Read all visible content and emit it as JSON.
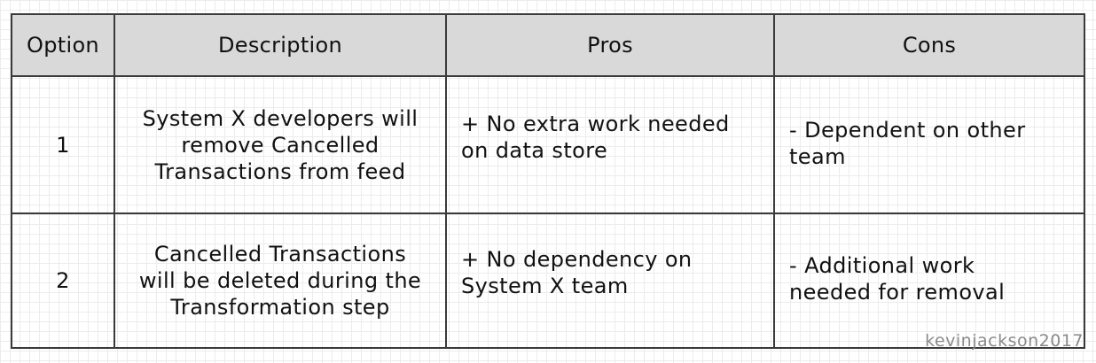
{
  "table": {
    "headers": {
      "option": "Option",
      "description": "Description",
      "pros": "Pros",
      "cons": "Cons"
    },
    "rows": [
      {
        "option": "1",
        "description": "System X developers will\nremove Cancelled\nTransactions from feed",
        "pros": "+ No extra work needed\non data store",
        "cons": "- Dependent on other\nteam"
      },
      {
        "option": "2",
        "description": "Cancelled Transactions\nwill be deleted during the\nTransformation step",
        "pros": "+ No dependency on\nSystem X team",
        "cons": "- Additional work\nneeded for removal"
      }
    ]
  },
  "watermark": "kevinjackson2017",
  "colors": {
    "header_bg": "#d9d9d9",
    "border": "#3a3a3a",
    "grid": "#ececec",
    "watermark": "#8a8a8a"
  }
}
